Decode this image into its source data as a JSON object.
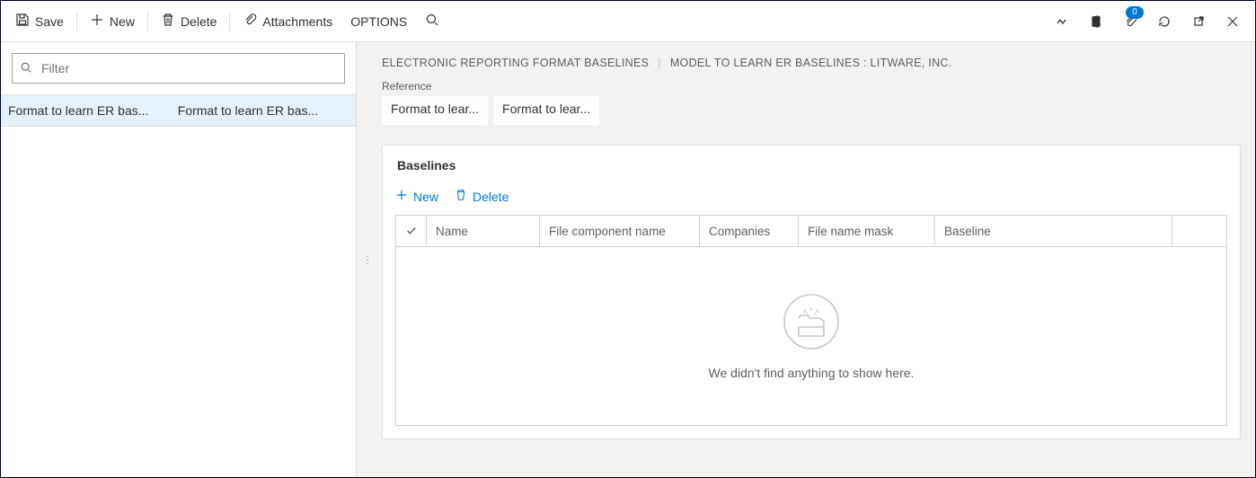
{
  "toolbar": {
    "save_label": "Save",
    "new_label": "New",
    "delete_label": "Delete",
    "attachments_label": "Attachments",
    "options_label": "OPTIONS",
    "attachment_badge": "0"
  },
  "left": {
    "filter_placeholder": "Filter",
    "row": {
      "col1": "Format to learn ER bas...",
      "col2": "Format to learn ER bas..."
    }
  },
  "breadcrumb": {
    "seg1": "ELECTRONIC REPORTING FORMAT BASELINES",
    "seg2": "MODEL TO LEARN ER BASELINES : LITWARE, INC."
  },
  "reference": {
    "label": "Reference",
    "pill1": "Format to lear...",
    "pill2": "Format to lear..."
  },
  "panel": {
    "title": "Baselines",
    "new_label": "New",
    "delete_label": "Delete",
    "columns": {
      "name": "Name",
      "file_component": "File component name",
      "companies": "Companies",
      "file_mask": "File name mask",
      "baseline": "Baseline"
    },
    "empty_text": "We didn't find anything to show here."
  }
}
